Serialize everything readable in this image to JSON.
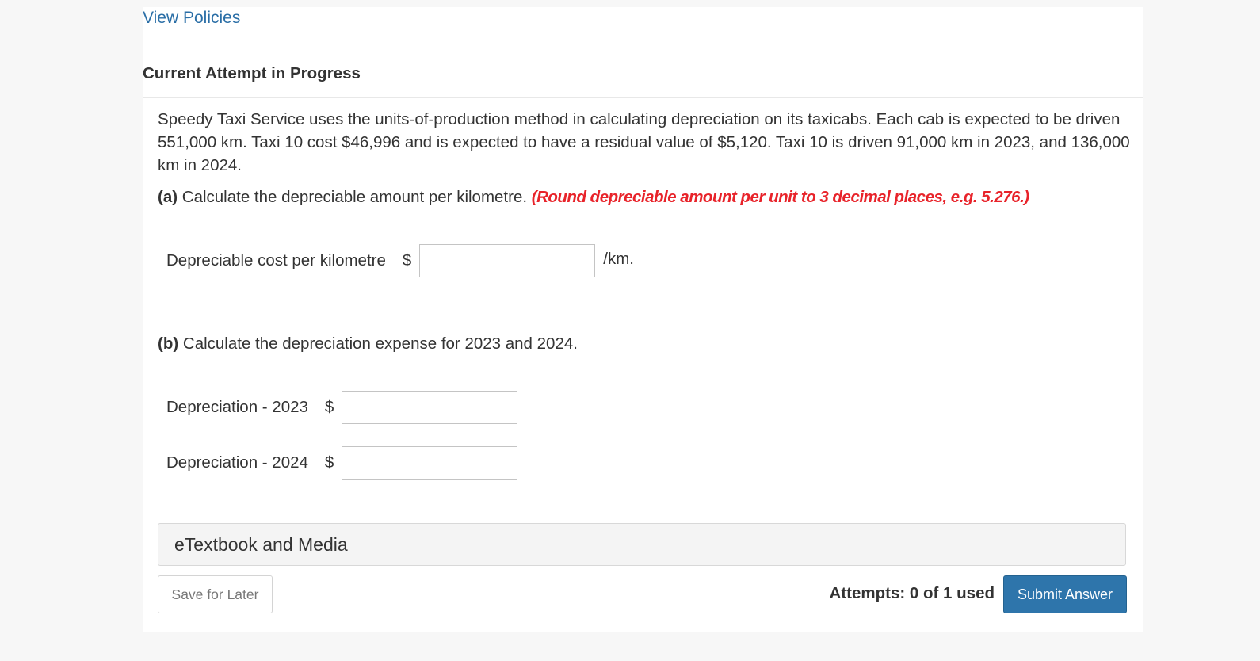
{
  "header": {
    "view_policies": "View Policies",
    "attempt_status": "Current Attempt in Progress"
  },
  "question": {
    "text": "Speedy Taxi Service uses the units-of-production method in calculating depreciation on its taxicabs. Each cab is expected to be driven 551,000 km. Taxi 10 cost $46,996 and is expected to have a residual value of $5,120. Taxi 10 is driven 91,000 km in 2023, and 136,000 km in 2024."
  },
  "part_a": {
    "tag": "(a)",
    "prompt": " Calculate the depreciable amount per kilometre. ",
    "instruction": "(Round depreciable amount per unit to 3 decimal places, e.g. 5.276.)",
    "field_label": "Depreciable cost per kilometre",
    "currency": "$",
    "value": "",
    "unit": "/km."
  },
  "part_b": {
    "tag": "(b)",
    "prompt": " Calculate the depreciation expense for 2023 and 2024.",
    "rows": [
      {
        "label": "Depreciation - 2023",
        "currency": "$",
        "value": ""
      },
      {
        "label": "Depreciation - 2024",
        "currency": "$",
        "value": ""
      }
    ]
  },
  "resources": {
    "etextbook": "eTextbook and Media"
  },
  "footer": {
    "save_label": "Save for Later",
    "attempts": "Attempts: 0 of 1 used",
    "submit_label": "Submit Answer"
  },
  "colors": {
    "link": "#2a6ea6",
    "instruction": "#e8232a",
    "submit_bg": "#2e75ab"
  }
}
